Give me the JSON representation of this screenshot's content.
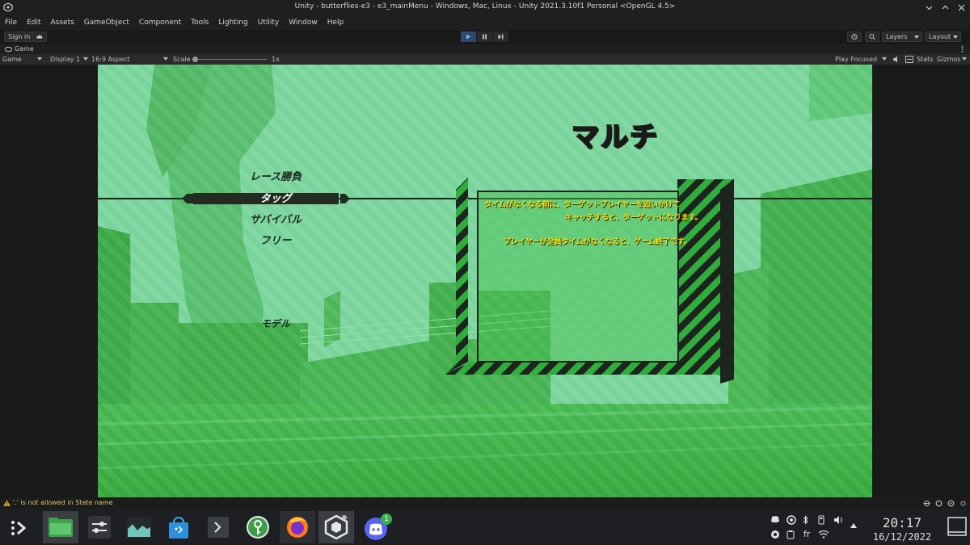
{
  "window": {
    "title": "Unity - butterflies-e3 - e3_mainMenu - Windows, Mac, Linux - Unity 2021.3.10f1 Personal <OpenGL 4.5>"
  },
  "menu": [
    "File",
    "Edit",
    "Assets",
    "GameObject",
    "Component",
    "Tools",
    "Lighting",
    "Utility",
    "Window",
    "Help"
  ],
  "toolbar": {
    "sign_in": "Sign in",
    "layers": "Layers",
    "layout": "Layout"
  },
  "game_tab": {
    "name": "Game",
    "mode": "Game",
    "display": "Display 1",
    "aspect": "16:9 Aspect",
    "scale_label": "Scale",
    "scale_value": "1x",
    "play_focused": "Play Focused",
    "stats": "Stats",
    "gizmos": "Gizmos"
  },
  "game": {
    "mode_title": "マルチ",
    "menu_items": [
      "レース勝負",
      "タッグ",
      "サバイバル",
      "フリー"
    ],
    "selected_item": "タッグ",
    "model_label": "モデル",
    "description_line1": "タイムがなくなる前に、ターゲットプレイヤーを追いかけて",
    "description_line2": "キャッチすると、ターゲットになります。",
    "description_line3": "プレイヤーが全員タイムがなくなると、ゲーム終了です。"
  },
  "status": {
    "message": "'.' is not allowed in State name"
  },
  "taskbar": {
    "discord_badge": "1",
    "lang": "fr",
    "time": "20:17",
    "date": "16/12/2022"
  },
  "colors": {
    "green_bg": "#6fd08f",
    "green_dark": "#2fae3d",
    "title_yellow": "#ffe600",
    "panel_dark": "#1e2a1e",
    "play_active": "#2f4a6a"
  }
}
